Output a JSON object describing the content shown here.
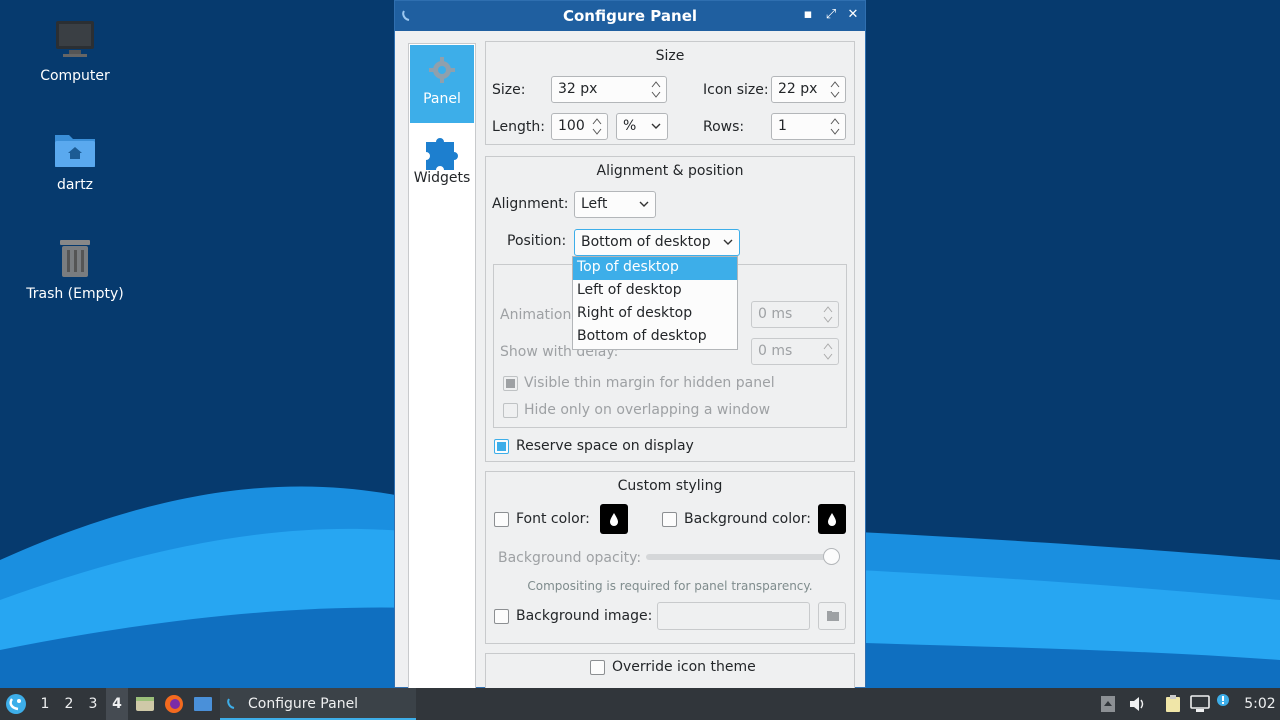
{
  "desktop": {
    "icons": [
      {
        "label": "Computer"
      },
      {
        "label": "dartz"
      },
      {
        "label": "Trash (Empty)"
      }
    ]
  },
  "window": {
    "title": "Configure Panel",
    "sidebar": [
      {
        "label": "Panel",
        "icon": "gear-icon",
        "active": true
      },
      {
        "label": "Widgets",
        "icon": "puzzle-icon",
        "active": false
      }
    ],
    "size_group": {
      "title": "Size",
      "size_label": "Size:",
      "size_value": "32 px",
      "icon_size_label": "Icon size:",
      "icon_size_value": "22 px",
      "length_label": "Length:",
      "length_value": "100",
      "length_unit": "%",
      "rows_label": "Rows:",
      "rows_value": "1"
    },
    "alignment_group": {
      "title": "Alignment & position",
      "alignment_label": "Alignment:",
      "alignment_value": "Left",
      "position_label": "Position:",
      "position_value": "Bottom of desktop",
      "position_options": [
        "Top of desktop",
        "Left of desktop",
        "Right of desktop",
        "Bottom of desktop"
      ],
      "highlighted_option": "Top of desktop",
      "animation_label": "Animation",
      "animation_value": "0 ms",
      "show_delay_label": "Show with delay:",
      "show_delay_value": "0 ms",
      "thin_margin_label": "Visible thin margin for hidden panel",
      "overlap_label": "Hide only on overlapping a window",
      "reserve_space_label": "Reserve space on display"
    },
    "styling_group": {
      "title": "Custom styling",
      "font_color_label": "Font color:",
      "bg_color_label": "Background color:",
      "bg_opacity_label": "Background opacity:",
      "compositing_note": "Compositing is required for panel transparency.",
      "bg_image_label": "Background image:",
      "bg_image_value": ""
    },
    "override_icon_label": "Override icon theme"
  },
  "taskbar": {
    "desktops": [
      "1",
      "2",
      "3",
      "4"
    ],
    "active_desktop": "4",
    "task_label": "Configure Panel",
    "clock": "5:02"
  },
  "colors": {
    "accent": "#3daee9",
    "taskbar": "#31363b",
    "titlebar": "#1f5fa0"
  }
}
